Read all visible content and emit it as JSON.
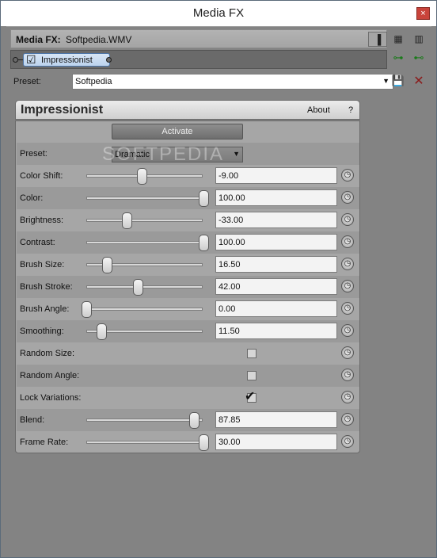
{
  "window": {
    "title": "Media FX",
    "close_icon": "×"
  },
  "header": {
    "label": "Media FX:",
    "value": "Softpedia.WMV"
  },
  "view_buttons": [
    "▐",
    "▦",
    "▥"
  ],
  "chain": {
    "plugin_label": "Impressionist",
    "checked": true
  },
  "preset_bar": {
    "label": "Preset:",
    "value": "Softpedia"
  },
  "panel": {
    "title": "Impressionist",
    "about": "About",
    "help": "?",
    "activate_label": "Activate",
    "preset_label": "Preset:",
    "preset_value": "Dramatic",
    "watermark": "SOFTPEDIA"
  },
  "params": [
    {
      "label": "Color Shift:",
      "value": "-9.00",
      "level": 0.45
    },
    {
      "label": "Color:",
      "value": "100.00",
      "level": 1.0
    },
    {
      "label": "Brightness:",
      "value": "-33.00",
      "level": 0.33
    },
    {
      "label": "Contrast:",
      "value": "100.00",
      "level": 1.0
    },
    {
      "label": "Brush Size:",
      "value": "16.50",
      "level": 0.17
    },
    {
      "label": "Brush Stroke:",
      "value": "42.00",
      "level": 0.42
    },
    {
      "label": "Brush Angle:",
      "value": "0.00",
      "level": 0.0
    },
    {
      "label": "Smoothing:",
      "value": "11.50",
      "level": 0.12
    }
  ],
  "toggles": [
    {
      "label": "Random Size:",
      "checked": false
    },
    {
      "label": "Random Angle:",
      "checked": false
    },
    {
      "label": "Lock Variations:",
      "checked": true
    }
  ],
  "params2": [
    {
      "label": "Blend:",
      "value": "87.85",
      "level": 0.88
    },
    {
      "label": "Frame Rate:",
      "value": "30.00",
      "level": 1.0
    }
  ]
}
